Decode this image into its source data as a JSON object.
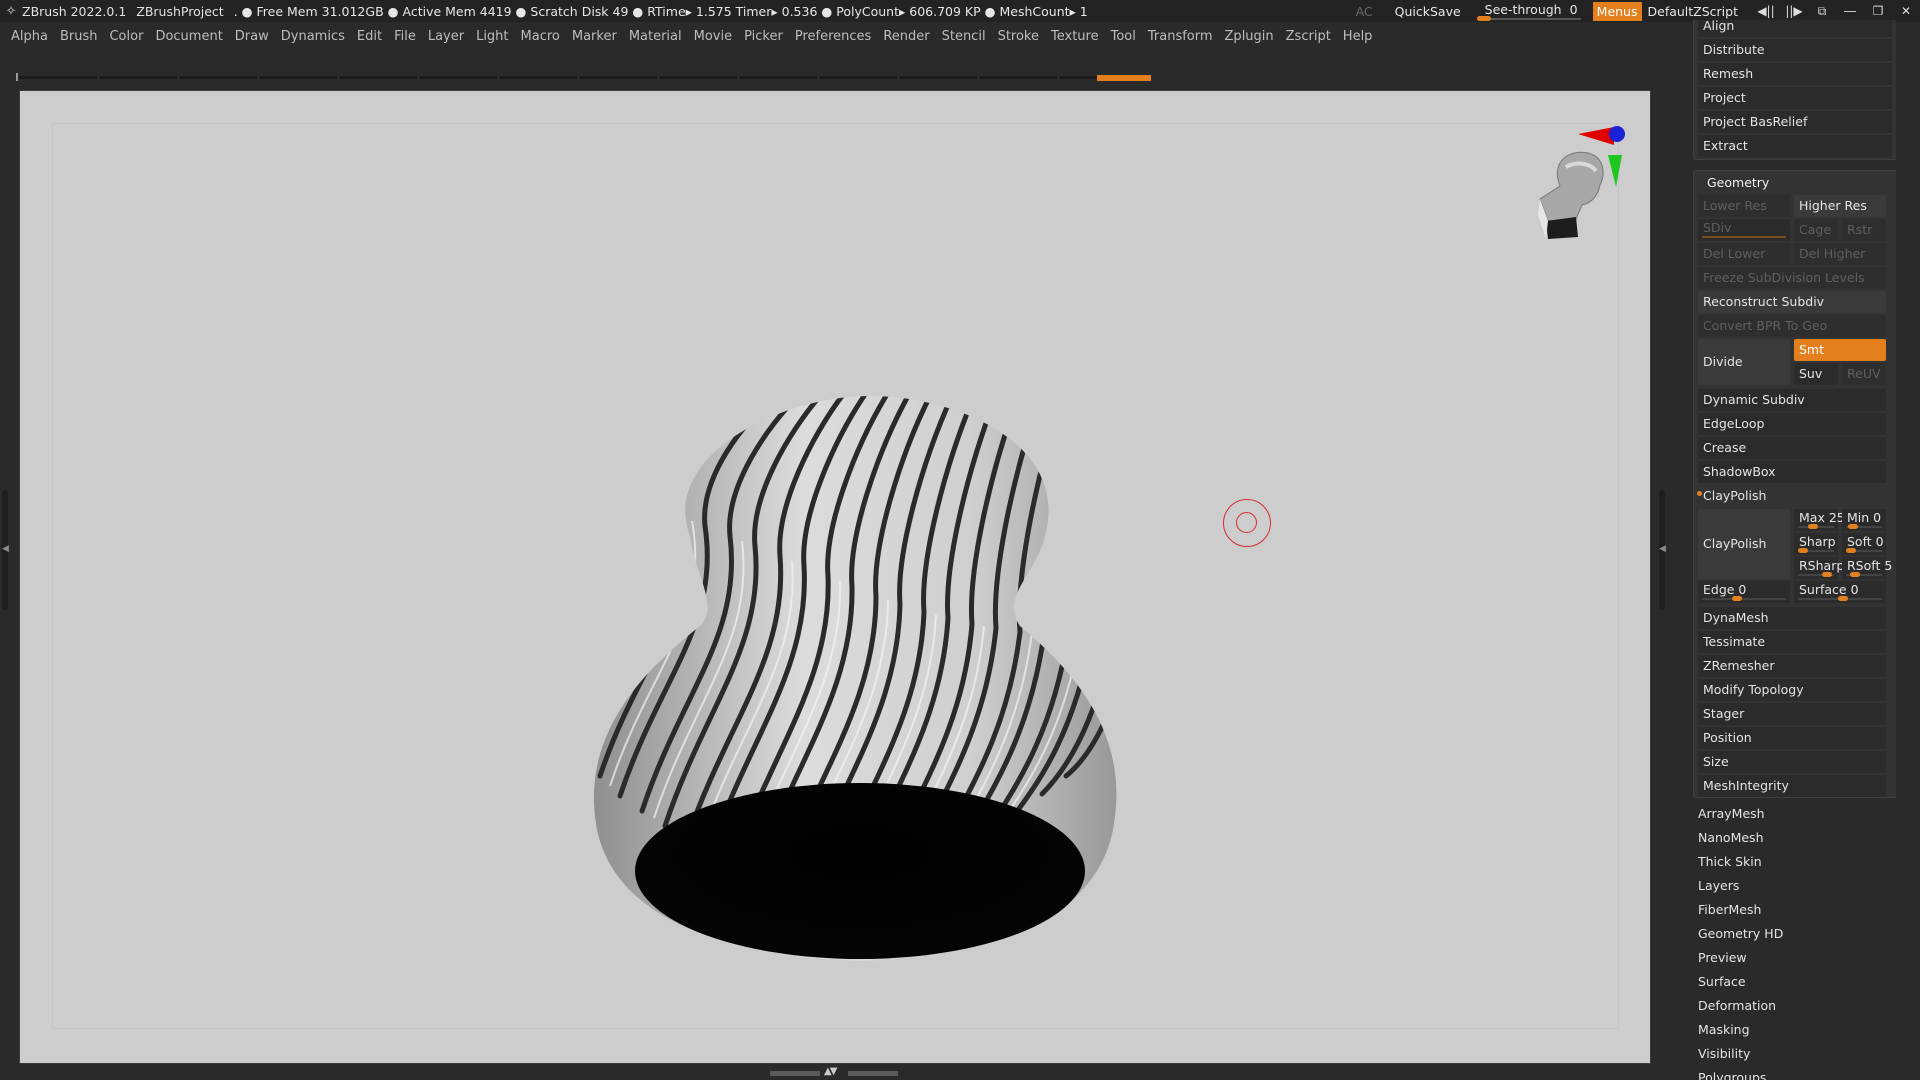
{
  "titlebar": {
    "app": "ZBrush 2022.0.1",
    "project": "ZBrushProject",
    "stats": ". ● Free Mem 31.012GB ● Active Mem 4419 ● Scratch Disk 49 ●  RTime▸ 1.575 Timer▸ 0.536 ● PolyCount▸ 606.709 KP  ● MeshCount▸ 1",
    "ac": "AC",
    "quicksave": "QuickSave",
    "seethrough_label": "See-through",
    "seethrough_value": "0",
    "seethrough_level": 0.0,
    "menus": "Menus",
    "script": "DefaultZScript",
    "icons": [
      "layout-arrows-icon",
      "layout-cycle-icon",
      "window-swap-icon",
      "minimize-icon",
      "restore-icon",
      "close-icon"
    ]
  },
  "menubar": [
    "Alpha",
    "Brush",
    "Color",
    "Document",
    "Draw",
    "Dynamics",
    "Edit",
    "File",
    "Layer",
    "Light",
    "Macro",
    "Marker",
    "Material",
    "Movie",
    "Picker",
    "Preferences",
    "Render",
    "Stencil",
    "Stroke",
    "Texture",
    "Tool",
    "Transform",
    "Zplugin",
    "Zscript",
    "Help"
  ],
  "colors": {
    "accent": "#e47f1e",
    "viewport_bg": "#cdcdcd",
    "panel_bg": "#333333",
    "cursor_ring": "#d62c2c"
  },
  "panel": {
    "top_list": [
      "Align",
      "Distribute",
      "Remesh",
      "Project",
      "Project BasRelief",
      "Extract"
    ],
    "geometry": {
      "title": "Geometry",
      "lower_res": "Lower Res",
      "higher_res": "Higher Res",
      "sdiv": "SDiv",
      "cage": "Cage",
      "rstr": "Rstr",
      "del_lower": "Del Lower",
      "del_higher": "Del Higher",
      "freeze": "Freeze SubDivision Levels",
      "reconstruct": "Reconstruct Subdiv",
      "convert_bpr": "Convert BPR To Geo",
      "divide": "Divide",
      "smt": "Smt",
      "suv": "Suv",
      "reuv": "ReUV",
      "items_a": [
        "Dynamic Subdiv",
        "EdgeLoop",
        "Crease",
        "ShadowBox"
      ],
      "claypolish_header": "ClayPolish",
      "claypolish_btn": "ClayPolish",
      "max": "Max 25",
      "min": "Min 0",
      "sharp": "Sharp",
      "soft": "Soft 0",
      "rsharp": "RSharp",
      "rsoft": "RSoft 5",
      "edge": "Edge 0",
      "surface": "Surface 0",
      "items_b": [
        "DynaMesh",
        "Tessimate",
        "ZRemesher",
        "Modify Topology",
        "Stager",
        "Position",
        "Size",
        "MeshIntegrity"
      ]
    },
    "sub_list": [
      "ArrayMesh",
      "NanoMesh",
      "Thick Skin",
      "Layers",
      "FiberMesh",
      "Geometry HD",
      "Preview",
      "Surface",
      "Deformation",
      "Masking",
      "Visibility",
      "Polygroups"
    ]
  }
}
